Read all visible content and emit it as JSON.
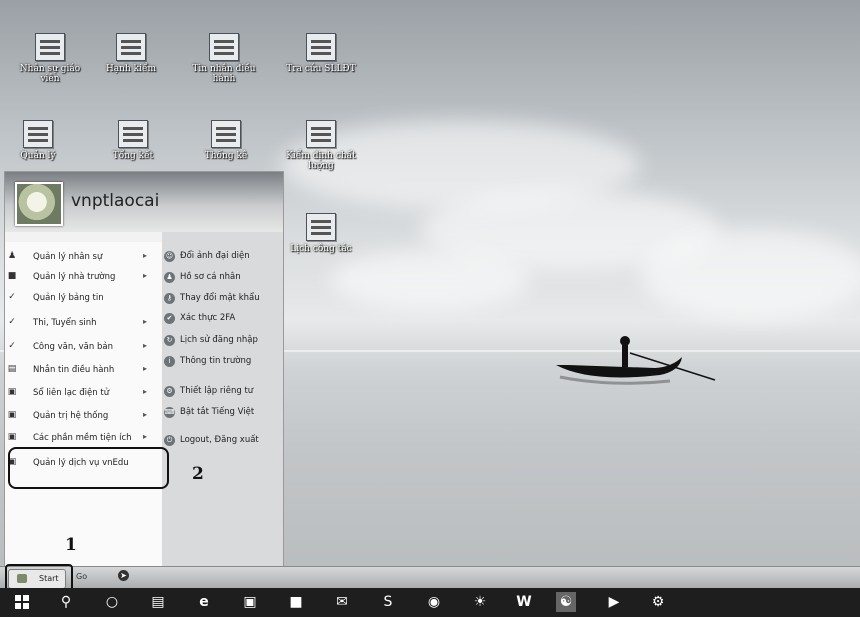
{
  "desktop": {
    "icons": [
      {
        "label": "Nhân sự giáo viên",
        "icon": "staff-icon"
      },
      {
        "label": "Hạnh kiểm",
        "icon": "conduct-chart-icon"
      },
      {
        "label": "Tin nhắn điều hành",
        "icon": "message-icon"
      },
      {
        "label": "Tra cứu SLLĐT",
        "icon": "lookup-icon"
      },
      {
        "label": "Quản lý",
        "icon": "manage-icon"
      },
      {
        "label": "Tổng kết",
        "icon": "sum-icon"
      },
      {
        "label": "Thống kê",
        "icon": "stats-icon"
      },
      {
        "label": "Kiểm định chất lượng",
        "icon": "quality-check-icon"
      },
      {
        "label": "Lịch công tác",
        "icon": "calendar-icon"
      }
    ]
  },
  "start_menu": {
    "username": "vnptlaocai",
    "left_items": [
      {
        "label": "Quản lý nhân sự",
        "arrow": "▸"
      },
      {
        "label": "Quản lý nhà trường",
        "arrow": "▸"
      },
      {
        "label": "Quản lý bảng tin",
        "arrow": ""
      },
      {
        "label": "Thi, Tuyển sinh",
        "arrow": "▸"
      },
      {
        "label": "Công văn, văn bản",
        "arrow": "▸"
      },
      {
        "label": "Nhắn tin điều hành",
        "arrow": "▸"
      },
      {
        "label": "Sổ liên lạc điện tử",
        "arrow": "▸"
      },
      {
        "label": "Quản trị hệ thống",
        "arrow": "▸"
      },
      {
        "label": "Các phần mềm tiện ích",
        "arrow": "▸"
      },
      {
        "label": "Quản lý dịch vụ vnEdu",
        "arrow": ""
      }
    ],
    "right_items": [
      {
        "label": "Đổi ảnh đại diện"
      },
      {
        "label": "Hồ sơ cá nhân"
      },
      {
        "label": "Thay đổi mật khẩu"
      },
      {
        "label": "Xác thực 2FA"
      },
      {
        "label": "Lịch sử đăng nhập"
      },
      {
        "label": "Thông tin trường"
      },
      {
        "label": "Thiết lập riêng tư"
      },
      {
        "label": "Bật tắt Tiếng Việt"
      },
      {
        "label": "Logout, Đăng xuất"
      }
    ]
  },
  "annotations": {
    "step1": "1",
    "step2": "2"
  },
  "start_bar": {
    "start_label": "Start",
    "go_label": "Go"
  },
  "taskbar": {
    "icons": [
      "windows-icon",
      "search-icon",
      "cortana-icon",
      "task-view-icon",
      "edge-icon",
      "app-icon",
      "store-icon",
      "mail-icon",
      "skype-icon",
      "chrome-icon",
      "photos-icon",
      "word-icon",
      "active-app-icon",
      "media-icon",
      "settings-icon"
    ]
  }
}
